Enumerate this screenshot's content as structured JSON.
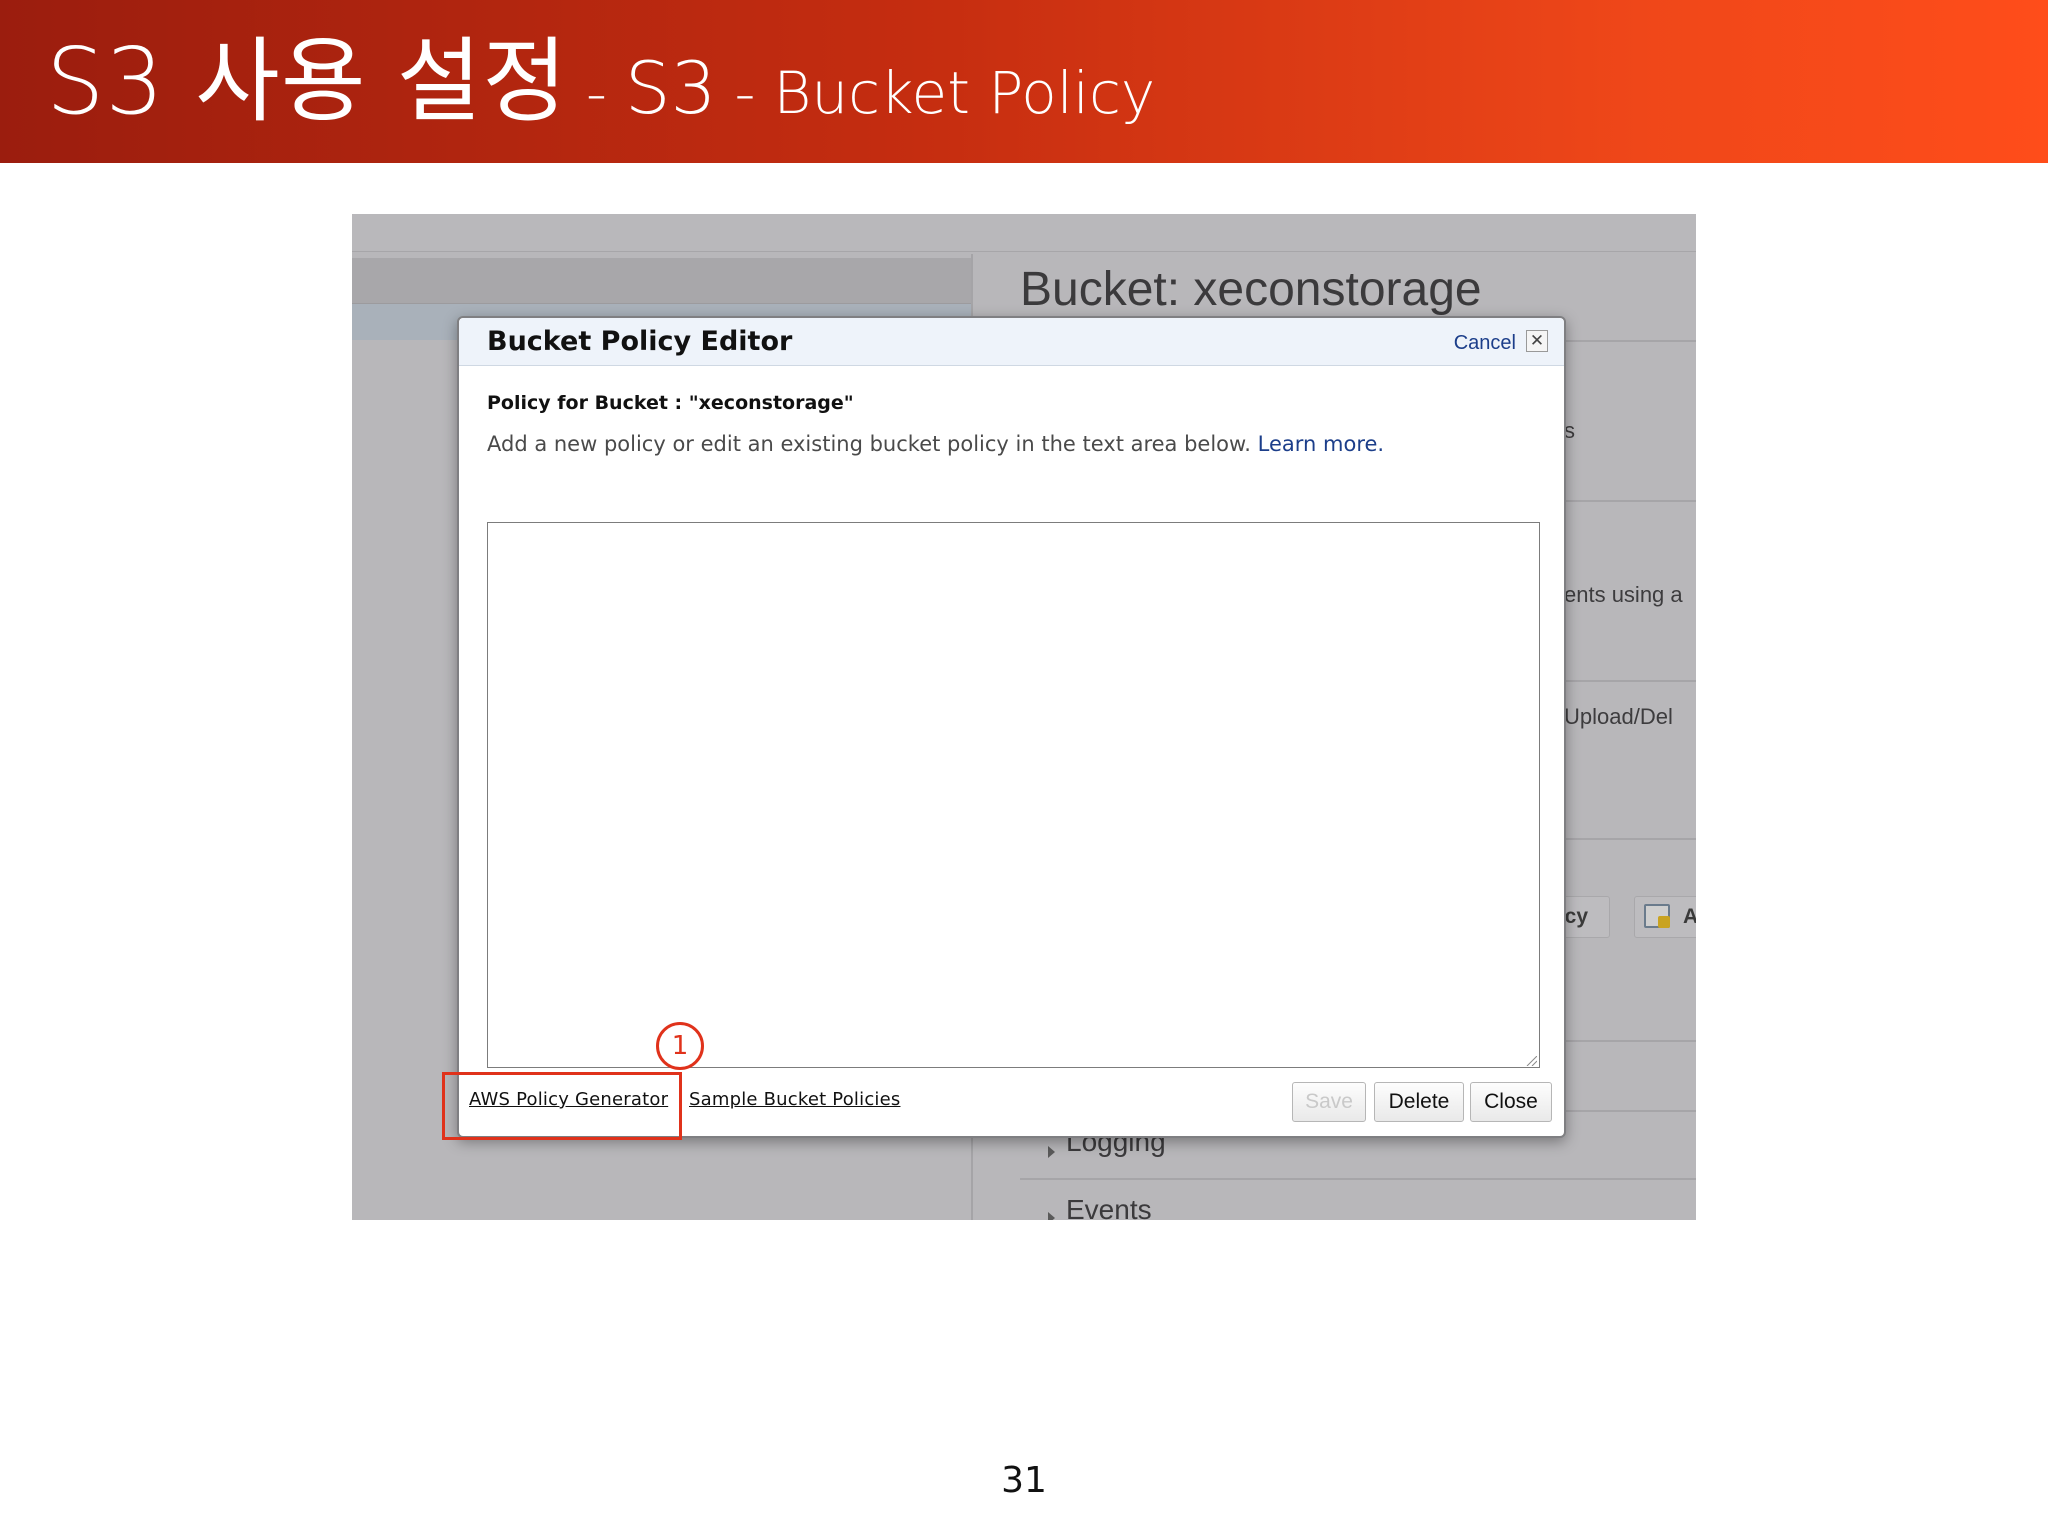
{
  "slide": {
    "title_main": "S3 사용 설정",
    "title_sep1": "-",
    "title_sub": "S3",
    "title_sep2": "-",
    "title_sub2": "Bucket Policy",
    "page_number": "31",
    "header_colors": [
      "#9b1d0e",
      "#ff4d1a"
    ]
  },
  "background": {
    "bucket_title": "Bucket: xeconstorage",
    "partial_texts": [
      "s",
      "ents using a",
      "Upload/Del"
    ],
    "tool_buttons": [
      "licy",
      "A"
    ],
    "sections": [
      "Logging",
      "Events"
    ]
  },
  "dialog": {
    "title": "Bucket Policy Editor",
    "cancel_label": "Cancel",
    "close_x": "✕",
    "subtitle": "Policy for Bucket : \"xeconstorage\"",
    "description": "Add a new policy or edit an existing bucket policy in the text area below.",
    "learn_more": "Learn more",
    "policy_text": "",
    "links": {
      "policy_generator": "AWS Policy Generator",
      "sample_policies": "Sample Bucket Policies"
    },
    "buttons": {
      "save": "Save",
      "delete": "Delete",
      "close": "Close"
    }
  },
  "annotation": {
    "step_number": "1",
    "color": "#e0321b"
  }
}
